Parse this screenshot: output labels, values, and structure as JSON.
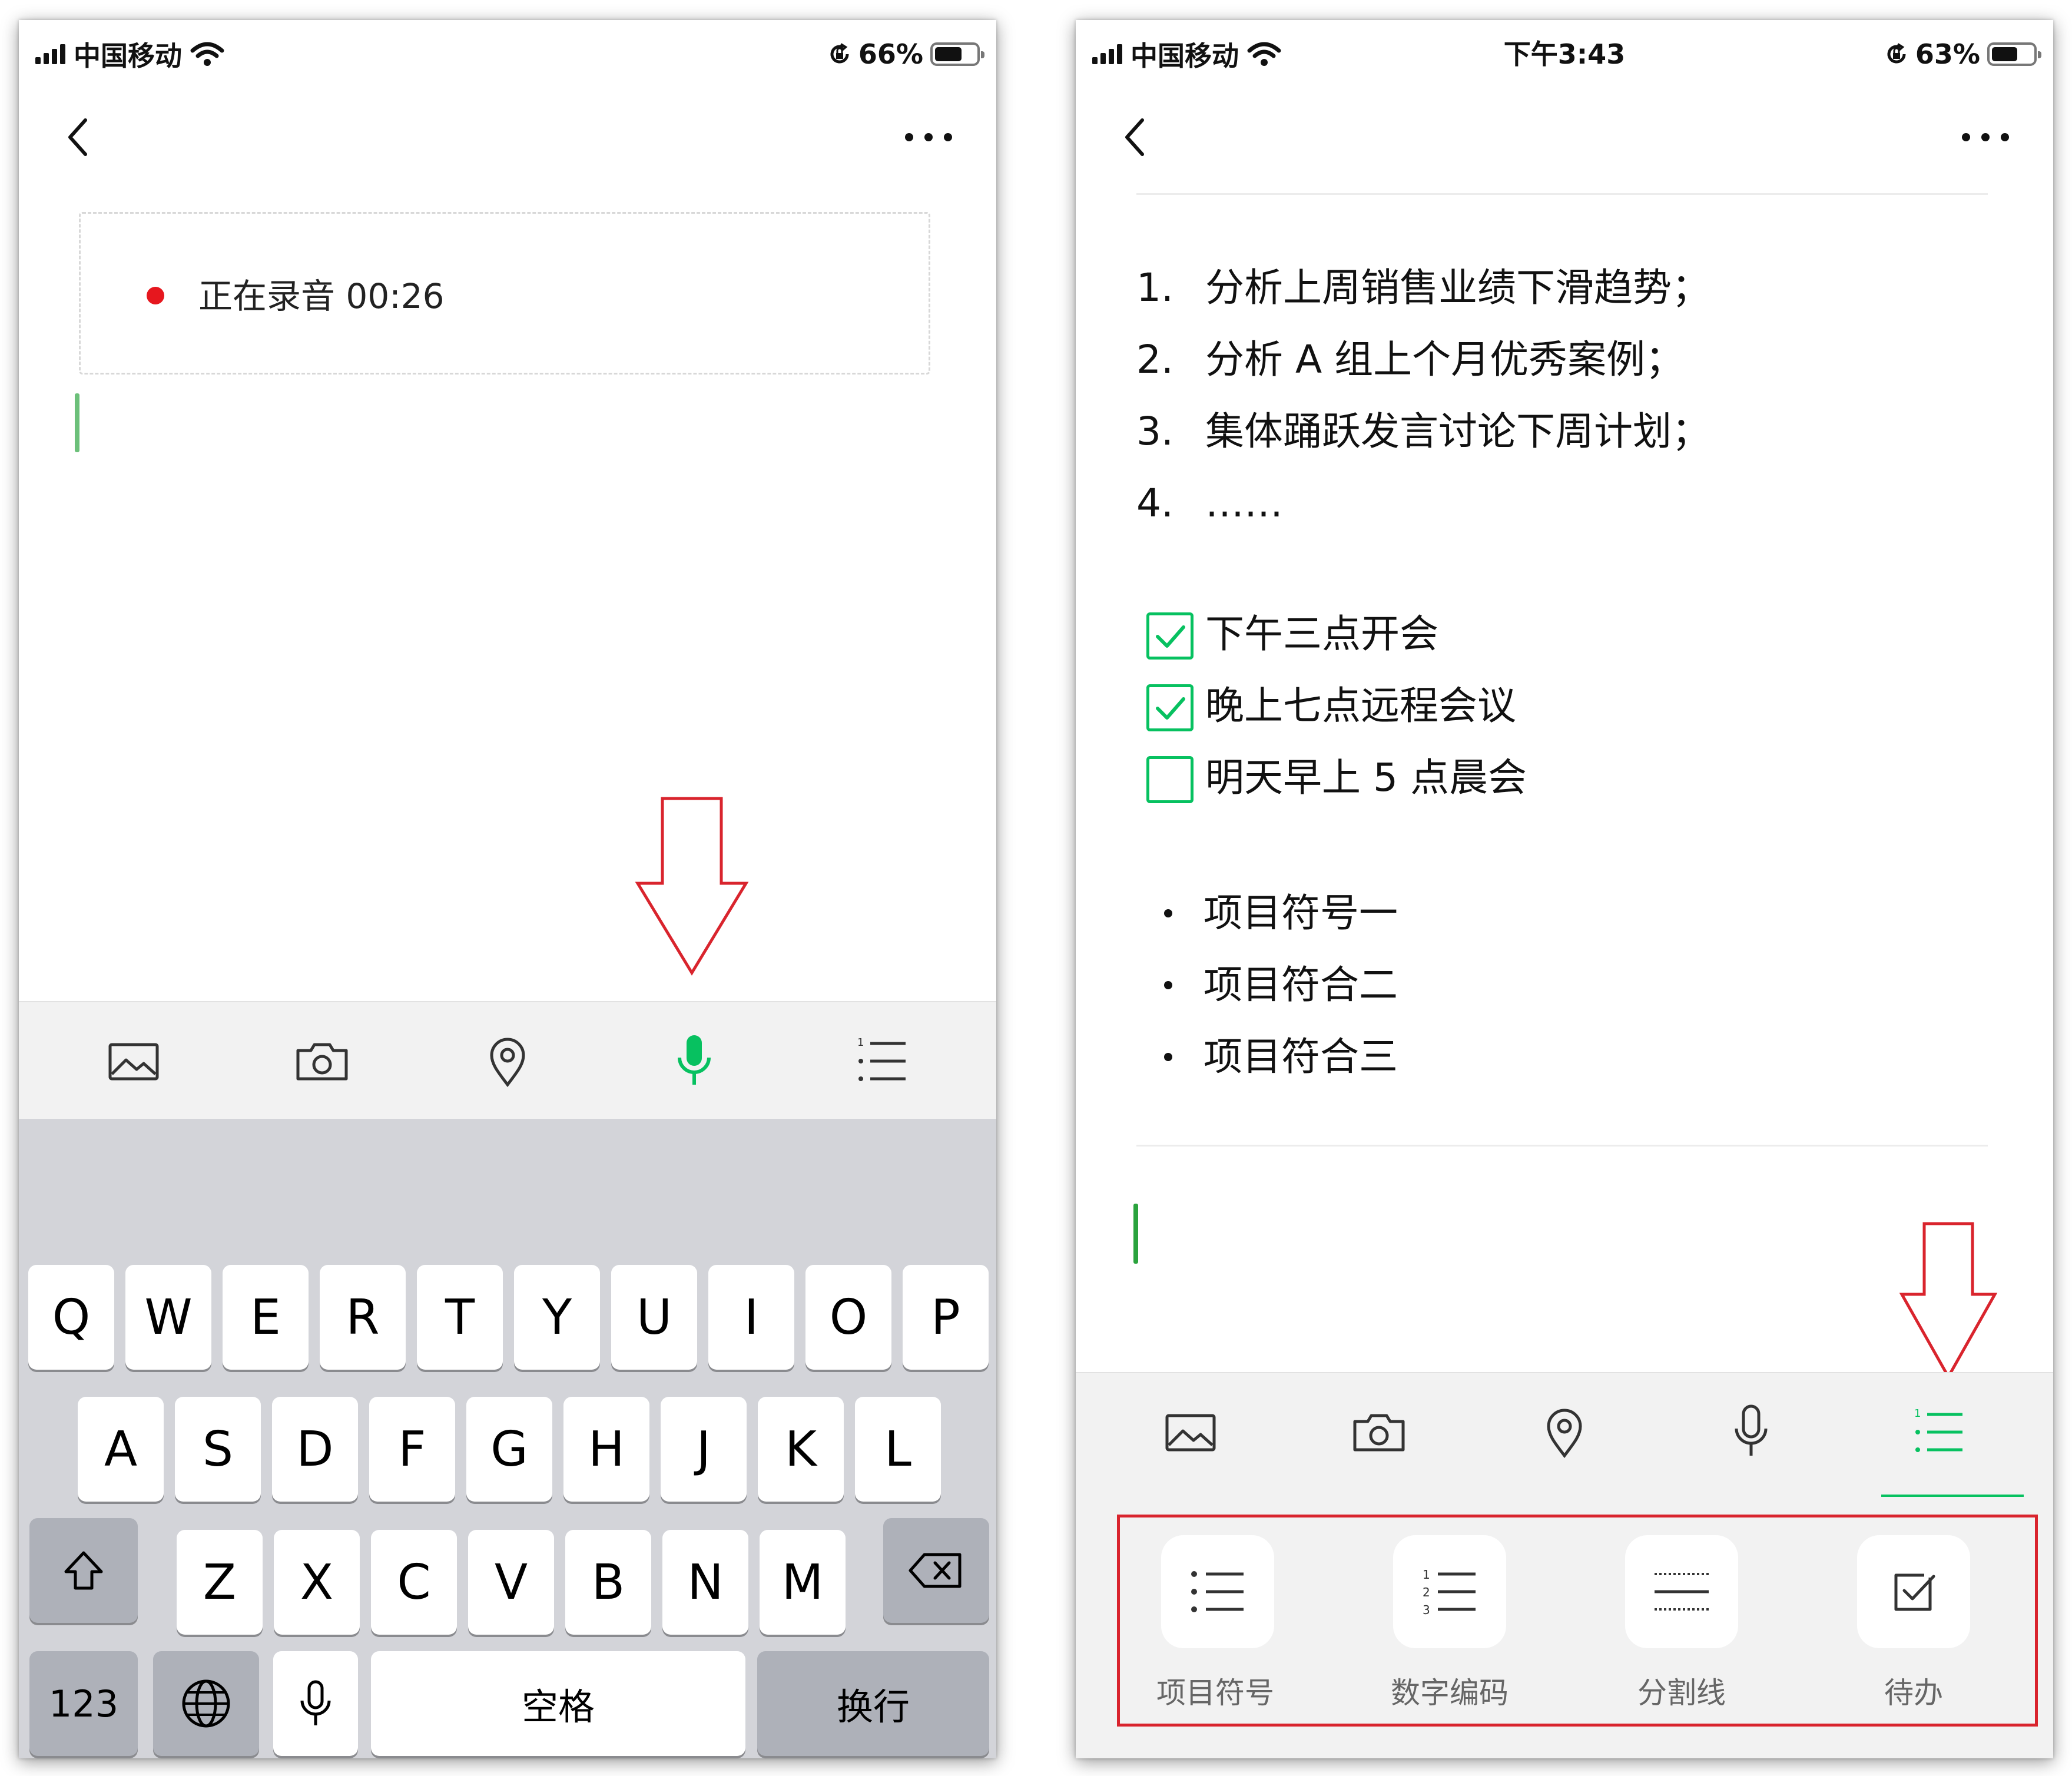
{
  "status_left": {
    "carrier": "中国移动",
    "battery_percent": "66%",
    "battery_level": 0.66
  },
  "status_right": {
    "carrier": "中国移动",
    "time": "下午3:43",
    "battery_percent": "63%",
    "battery_level": 0.63
  },
  "recording": {
    "text": "正在录音 00:26"
  },
  "toolbar": {
    "items": [
      "image-icon",
      "camera-icon",
      "location-icon",
      "microphone-icon",
      "list-icon"
    ]
  },
  "keyboard": {
    "row1": [
      "Q",
      "W",
      "E",
      "R",
      "T",
      "Y",
      "U",
      "I",
      "O",
      "P"
    ],
    "row2": [
      "A",
      "S",
      "D",
      "F",
      "G",
      "H",
      "J",
      "K",
      "L"
    ],
    "row3": [
      "Z",
      "X",
      "C",
      "V",
      "B",
      "N",
      "M"
    ],
    "numbers_key": "123",
    "space_key": "空格",
    "return_key": "换行"
  },
  "note": {
    "ordered_list": [
      {
        "num": "1.",
        "text": "分析上周销售业绩下滑趋势；"
      },
      {
        "num": "2.",
        "text": "分析 A 组上个月优秀案例；"
      },
      {
        "num": "3.",
        "text": "集体踊跃发言讨论下周计划；"
      },
      {
        "num": "4.",
        "text": "……"
      }
    ],
    "todos": [
      {
        "text": "下午三点开会",
        "checked": true
      },
      {
        "text": "晚上七点远程会议",
        "checked": true
      },
      {
        "text": "明天早上 5 点晨会",
        "checked": false
      }
    ],
    "bullets": [
      "项目符号一",
      "项目符合二",
      "项目符合三"
    ]
  },
  "format_panel": {
    "bullet_list": "项目符号",
    "numbered_list": "数字编码",
    "divider": "分割线",
    "todo": "待办"
  },
  "colors": {
    "accent_green": "#07c160",
    "recording_red": "#e6171e",
    "annotation_red": "#d9242d"
  }
}
